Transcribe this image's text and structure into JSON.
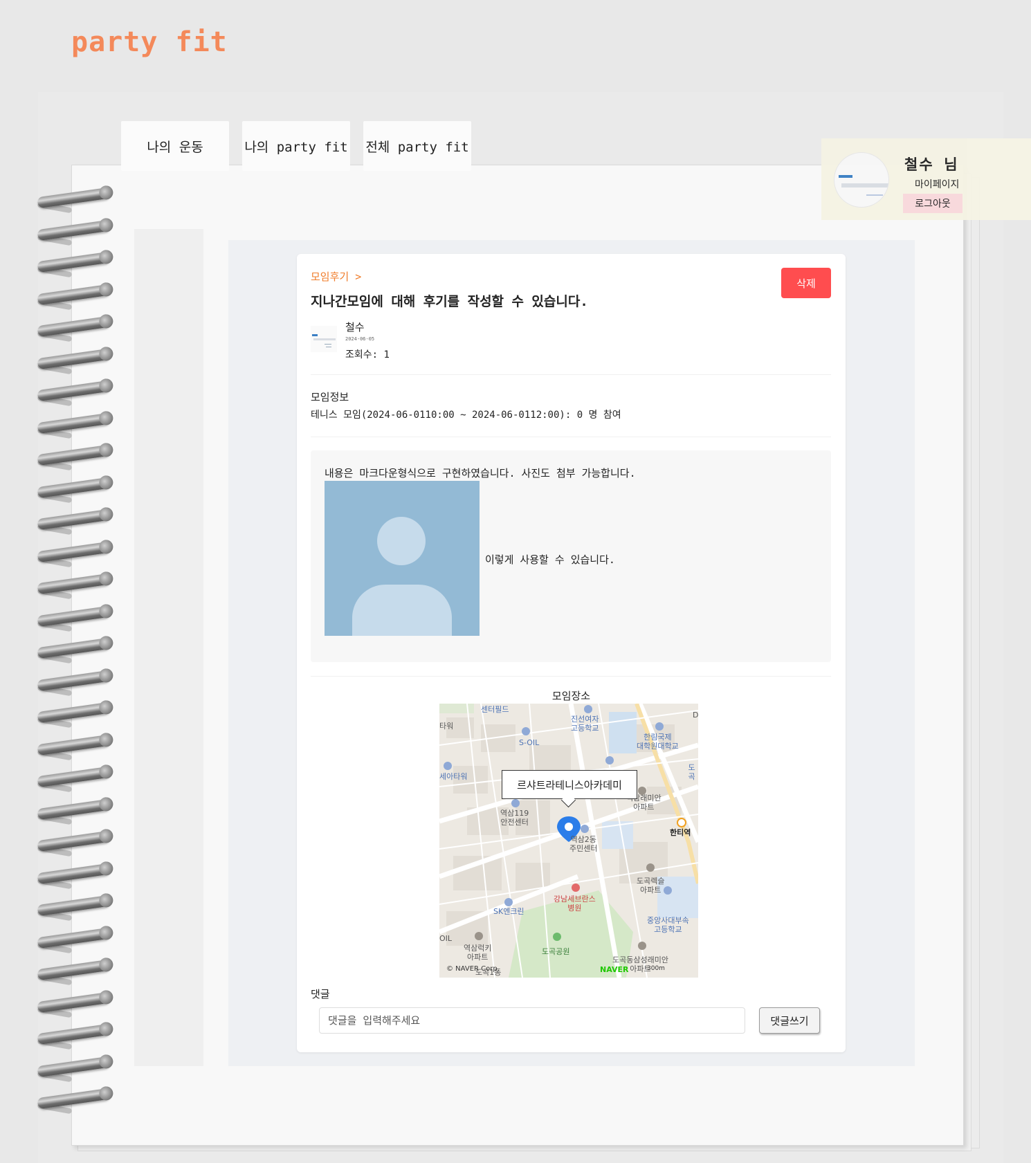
{
  "brand": {
    "logo_text": "party fit"
  },
  "tabs": [
    {
      "label": "나의 운동"
    },
    {
      "label": "나의 party fit"
    },
    {
      "label": "전체 party fit"
    }
  ],
  "profile": {
    "name": "철수 님",
    "mypage_label": "마이페이지",
    "logout_label": "로그아웃"
  },
  "post": {
    "breadcrumb": "모임후기 >",
    "delete_label": "삭제",
    "title": "지나간모임에 대해 후기를 작성할 수 있습니다.",
    "author": "철수",
    "date": "2024-06-05",
    "views": "조회수: 1",
    "meeting_info_label": "모임정보",
    "meeting_info": "테니스 모임(2024-06-0110:00 ~ 2024-06-0112:00): 0 명 참여",
    "content_text": "내용은 마크다운형식으로 구현하였습니다. 사진도 첨부 가능합니다.",
    "content_after_image": "이렇게 사용할 수 있습니다."
  },
  "map": {
    "title": "모임장소",
    "marker_label": "르샤트라테니스아카데미",
    "labels": {
      "center_field": "센터필드",
      "jinseon": "진선여자\n고등학교",
      "hallym": "한림국제\n대학원대학교",
      "soil": "S-OIL",
      "sea_tower": "세아타워",
      "raemian": "역삼래미안\n아파트",
      "station119": "역삼119\n안전센터",
      "yeoksam2": "역삼2동\n주민센터",
      "hanti": "한티역",
      "dogok_rexle": "도곡렉슬\n아파트",
      "severance": "강남세브란스\n병원",
      "sk": "SK엔크린",
      "chungang": "중앙사대부속\n고등학교",
      "yeoksam_lucky": "역삼럭키\n아파트",
      "dogok_park": "도곡공원",
      "dogok_samsung": "도곡동삼성래미안\n아파트",
      "tower_left": "타워",
      "oil_left": "OIL",
      "dogok_right": "도곡",
      "d_right": "D",
      "dogok1": "도곡1동"
    },
    "copyright": "© NAVER Corp.",
    "naver_logo": "NAVER",
    "scale": "300m"
  },
  "comments": {
    "label": "댓글",
    "placeholder": "댓글을 입력해주세요",
    "submit_label": "댓글쓰기"
  },
  "colors": {
    "brand_orange": "#f4895a",
    "breadcrumb_orange": "#f07c2a",
    "delete_red": "#ff4d4f",
    "logout_pink": "#f9d8dc",
    "profile_bg": "#f5f3e4",
    "naver_green": "#1ec800"
  }
}
